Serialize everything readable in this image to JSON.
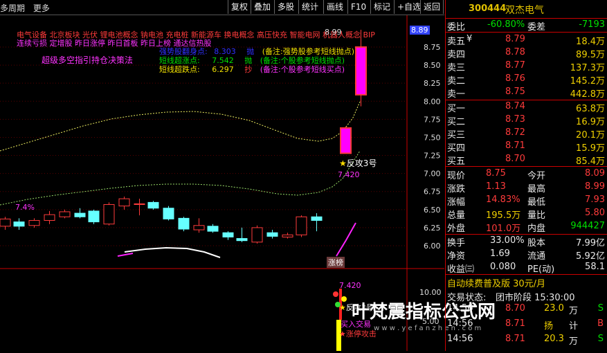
{
  "toolbar": {
    "period_label": "多周期",
    "more_label": "更多",
    "buttons": [
      "复权",
      "叠加",
      "多股",
      "统计",
      "画线",
      "F10",
      "标记",
      "+自选",
      "返回"
    ]
  },
  "concepts": {
    "line1": "电气设备  北京板块  光伏 锂电池概念 钠电池 充电桩 新能源车 换电概念 高压快充 智能电网 机器人概念 BIP",
    "line2": "连续亏损 定增股 昨日涨停 昨日首板 昨日上榜 通达信热股"
  },
  "signals": {
    "strategy_label": "超级多空指引持仓决策法",
    "rows": [
      {
        "name": "强势股翻身点:",
        "value": "8.303",
        "action": "抛",
        "note": "(备注:强势股参考短线抛点)"
      },
      {
        "name": "短线超涨点:",
        "value": "7.542",
        "action": "抛",
        "note": "(备注:个股参考短线抛点)"
      },
      {
        "name": "短线超跌点:",
        "value": "6.297",
        "action": "抄",
        "note": "(备注:个股参考短线买点)"
      }
    ]
  },
  "chart_labels": {
    "pct": "7.4%",
    "high_price": "8.99",
    "fangong": "反攻3号",
    "fangong2": "反攻3号",
    "band_value": "7.420",
    "band_value2": "7.420",
    "zhangbang": "涨榜",
    "buy_signal": "买入交易",
    "limit_up": "涨停攻击",
    "current_tag": "8.89",
    "lower_value": "10.00",
    "lower_value2": "5.00",
    "watermark": "叶梵震指标公式网",
    "watermark_url": "w w w . y e f a n z h e n . c o m"
  },
  "chart_data": {
    "type": "candlestick",
    "y_ticks": [
      "8.75",
      "8.50",
      "8.25",
      "8.00",
      "7.75",
      "7.50",
      "7.25",
      "7.00",
      "6.75",
      "6.50",
      "6.25",
      "6.00"
    ],
    "ylim": [
      5.85,
      8.99
    ],
    "candles": [
      {
        "o": 6.27,
        "c": 6.37,
        "h": 6.4,
        "l": 6.22
      },
      {
        "o": 6.33,
        "c": 6.27,
        "h": 6.38,
        "l": 6.22
      },
      {
        "o": 6.28,
        "c": 6.35,
        "h": 6.38,
        "l": 6.25
      },
      {
        "o": 6.35,
        "c": 6.43,
        "h": 6.48,
        "l": 6.3
      },
      {
        "o": 6.4,
        "c": 6.47,
        "h": 6.5,
        "l": 6.38
      },
      {
        "o": 6.45,
        "c": 6.4,
        "h": 6.52,
        "l": 6.38
      },
      {
        "o": 6.48,
        "c": 6.33,
        "h": 6.5,
        "l": 6.3
      },
      {
        "o": 6.3,
        "c": 6.57,
        "h": 6.6,
        "l": 6.28
      },
      {
        "o": 6.55,
        "c": 6.65,
        "h": 6.68,
        "l": 6.5
      },
      {
        "o": 6.58,
        "c": 6.58,
        "h": 6.65,
        "l": 6.42
      },
      {
        "o": 6.6,
        "c": 6.52,
        "h": 6.62,
        "l": 6.5
      },
      {
        "o": 6.52,
        "c": 6.37,
        "h": 6.55,
        "l": 6.35
      },
      {
        "o": 6.38,
        "c": 6.23,
        "h": 6.4,
        "l": 6.2
      },
      {
        "o": 6.22,
        "c": 6.28,
        "h": 6.38,
        "l": 6.18
      },
      {
        "o": 6.27,
        "c": 6.2,
        "h": 6.3,
        "l": 6.18
      },
      {
        "o": 6.18,
        "c": 6.12,
        "h": 6.2,
        "l": 6.08
      },
      {
        "o": 6.1,
        "c": 6.07,
        "h": 6.25,
        "l": 6.05
      },
      {
        "o": 6.05,
        "c": 6.25,
        "h": 6.28,
        "l": 6.03
      },
      {
        "o": 6.18,
        "c": 6.13,
        "h": 6.22,
        "l": 6.1
      },
      {
        "o": 6.12,
        "c": 6.15,
        "h": 6.18,
        "l": 6.1
      },
      {
        "o": 6.15,
        "c": 6.4,
        "h": 6.42,
        "l": 6.12
      },
      {
        "o": 6.4,
        "c": 6.35,
        "h": 6.45,
        "l": 6.2
      },
      {
        "o": 7.28,
        "c": 7.63,
        "h": 7.65,
        "l": 7.28
      },
      {
        "o": 8.09,
        "c": 8.75,
        "h": 8.99,
        "l": 7.93
      }
    ]
  },
  "quote": {
    "code": "300444",
    "name": "双杰电气",
    "weibi_label": "委比",
    "weibi": "-60.80%",
    "weicha_label": "委差",
    "weicha": "-7193",
    "asks": [
      {
        "label": "卖五",
        "flag": "¥",
        "price": "8.79",
        "vol": "18.4万"
      },
      {
        "label": "卖四",
        "flag": "",
        "price": "8.78",
        "vol": "89.5万"
      },
      {
        "label": "卖三",
        "flag": "",
        "price": "8.77",
        "vol": "137.3万"
      },
      {
        "label": "卖二",
        "flag": "",
        "price": "8.76",
        "vol": "145.2万"
      },
      {
        "label": "卖一",
        "flag": "",
        "price": "8.75",
        "vol": "442.8万"
      }
    ],
    "bids": [
      {
        "label": "买一",
        "price": "8.74",
        "vol": "63.8万"
      },
      {
        "label": "买二",
        "price": "8.73",
        "vol": "16.9万"
      },
      {
        "label": "买三",
        "price": "8.72",
        "vol": "20.1万"
      },
      {
        "label": "买四",
        "price": "8.71",
        "vol": "15.9万"
      },
      {
        "label": "买五",
        "price": "8.70",
        "vol": "85.4万"
      }
    ],
    "stats": [
      {
        "l1": "现价",
        "v1": "8.75",
        "c1": "red",
        "l2": "今开",
        "v2": "8.09",
        "c2": "red"
      },
      {
        "l1": "涨跌",
        "v1": "1.13",
        "c1": "red",
        "l2": "最高",
        "v2": "8.99",
        "c2": "red"
      },
      {
        "l1": "涨幅",
        "v1": "14.83%",
        "c1": "red",
        "l2": "最低",
        "v2": "7.93",
        "c2": "red"
      },
      {
        "l1": "总量",
        "v1": "195.5万",
        "c1": "yellow",
        "l2": "量比",
        "v2": "5.80",
        "c2": "red"
      },
      {
        "l1": "外盘",
        "v1": "101.0万",
        "c1": "red",
        "l2": "内盘",
        "v2": "944427",
        "c2": "green"
      }
    ],
    "stats2": [
      {
        "l1": "换手",
        "v1": "33.00%",
        "l2": "股本",
        "v2": "7.99亿"
      },
      {
        "l1": "净资",
        "v1": "1.69",
        "l2": "流通",
        "v2": "5.92亿"
      },
      {
        "l1": "收益㈢",
        "v1": "0.080",
        "l2": "PE(动)",
        "v2": "58.1"
      }
    ],
    "promo": "自动续费普及版  30元/月",
    "trade_state": "交易状态:",
    "trade_state_value": "团市阶段 15:30:00",
    "ticks": [
      {
        "time": "14:56",
        "price": "8.70",
        "vol": "23.0",
        "flag": "万",
        "side": "S"
      },
      {
        "time": "14:56",
        "price": "8.71",
        "vol": "扬",
        "flag": "计",
        "side": "B"
      },
      {
        "time": "14:56",
        "price": "8.71",
        "vol": "20.3",
        "flag": "万",
        "side": "S"
      }
    ]
  }
}
